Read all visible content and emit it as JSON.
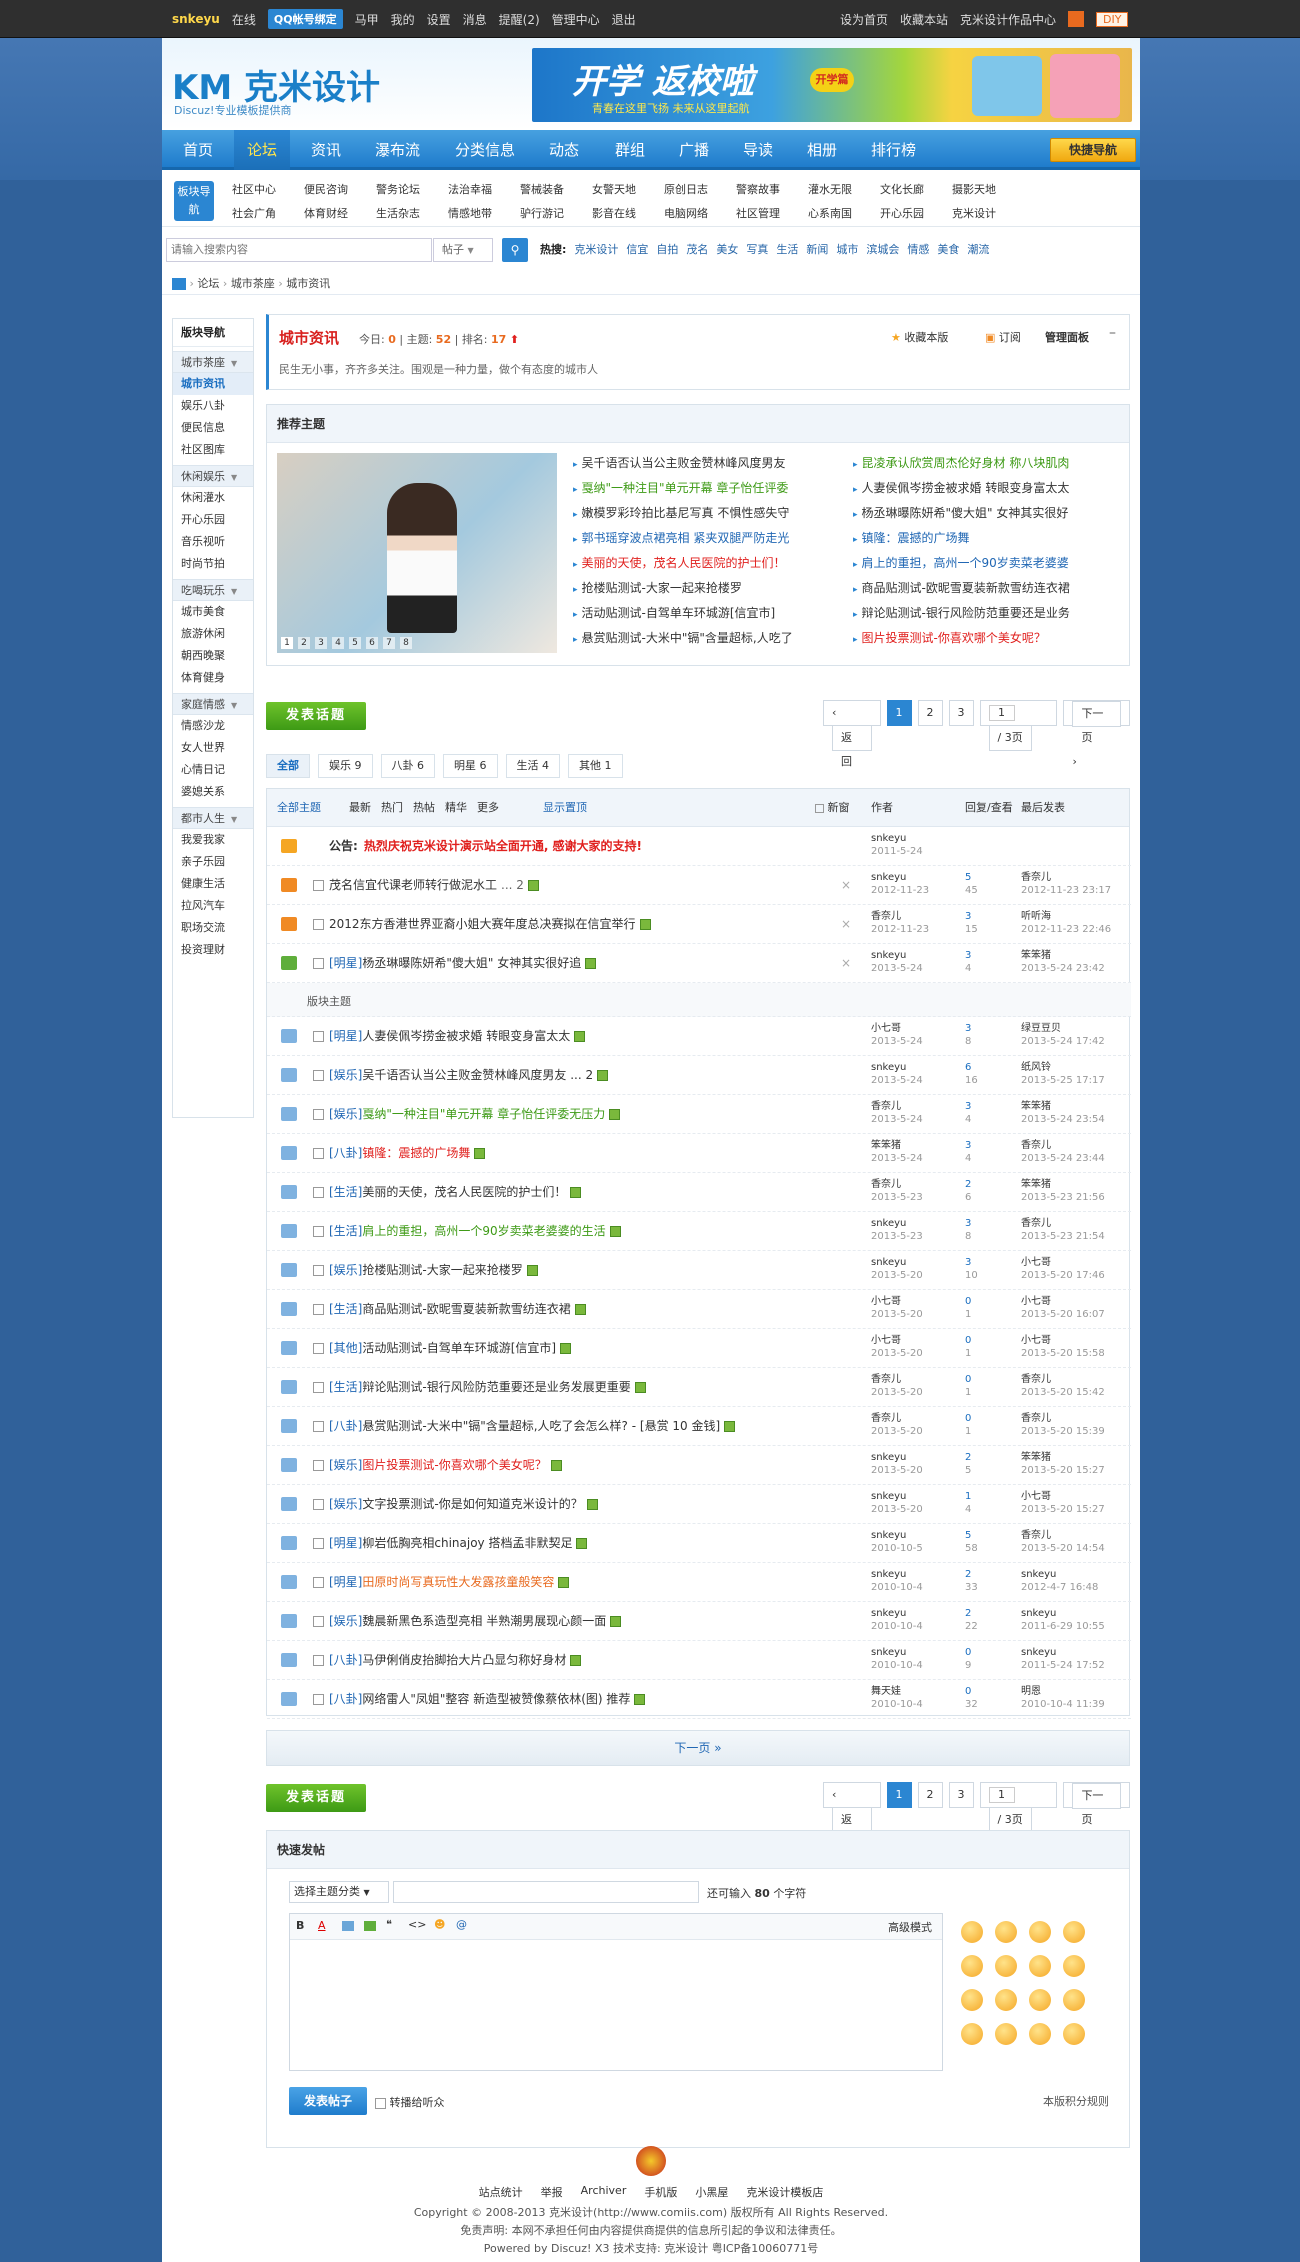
{
  "topbar": {
    "user": "snkeyu",
    "online": "在线",
    "qq": "QQ帐号绑定",
    "left_items": [
      "马甲",
      "我的",
      "设置",
      "消息",
      "提醒(2)",
      "管理中心",
      "退出"
    ],
    "right_items": [
      "设为首页",
      "收藏本站",
      "克米设计作品中心",
      "DIY"
    ]
  },
  "header": {
    "logo": "KM 克米设计",
    "tagline": "Discuz!专业模板提供商",
    "banner_title": "开学 返校啦",
    "banner_sub": "青春在这里飞扬 未来从这里起航",
    "banner_tag": "开学篇"
  },
  "nav": {
    "items": [
      "首页",
      "论坛",
      "资讯",
      "瀑布流",
      "分类信息",
      "动态",
      "群组",
      "广播",
      "导读",
      "相册",
      "排行榜"
    ],
    "quick": "快捷导航"
  },
  "subnav": {
    "label": "板块导航",
    "row1": [
      "社区中心",
      "便民咨询",
      "警务论坛",
      "法治幸福",
      "警械装备",
      "女警天地",
      "原创日志",
      "警察故事",
      "灌水无限",
      "文化长廊",
      "摄影天地"
    ],
    "row2": [
      "社会广角",
      "体育财经",
      "生活杂志",
      "情感地带",
      "驴行游记",
      "影音在线",
      "电脑网络",
      "社区管理",
      "心系南国",
      "开心乐园",
      "克米设计"
    ]
  },
  "search": {
    "placeholder": "请输入搜索内容",
    "type": "帖子",
    "hot_label": "热搜:",
    "hot": [
      "克米设计",
      "信宜",
      "自拍",
      "茂名",
      "美女",
      "写真",
      "生活",
      "新闻",
      "城市",
      "滨城会",
      "情感",
      "美食",
      "潮流"
    ]
  },
  "breadcrumb": [
    "论坛",
    "城市茶座",
    "城市资讯"
  ],
  "sidebar": {
    "title": "版块导航",
    "groups": [
      {
        "name": "城市茶座",
        "items": [
          "城市资讯",
          "娱乐八卦",
          "便民信息",
          "社区图库"
        ]
      },
      {
        "name": "休闲娱乐",
        "items": [
          "休闲灌水",
          "开心乐园",
          "音乐视听",
          "时尚节拍"
        ]
      },
      {
        "name": "吃喝玩乐",
        "items": [
          "城市美食",
          "旅游休闲",
          "朝西晚聚",
          "体育健身"
        ]
      },
      {
        "name": "家庭情感",
        "items": [
          "情感沙龙",
          "女人世界",
          "心情日记",
          "婆媳关系"
        ]
      },
      {
        "name": "都市人生",
        "items": [
          "我爱我家",
          "亲子乐园",
          "健康生活",
          "拉风汽车",
          "职场交流",
          "投资理财"
        ]
      }
    ]
  },
  "forum": {
    "name": "城市资讯",
    "today_label": "今日:",
    "today": "0",
    "threads_label": "主题:",
    "threads": "52",
    "rank_label": "排名:",
    "rank": "17",
    "desc": "民生无小事，齐齐多关注。围观是一种力量，做个有态度的城市人",
    "fav": "收藏本版",
    "rss": "订阅",
    "admin": "管理面板"
  },
  "featured": {
    "title": "推荐主题",
    "slides": [
      "1",
      "2",
      "3",
      "4",
      "5",
      "6",
      "7",
      "8"
    ],
    "left": [
      "吴千语否认当公主败金赞林峰风度男友",
      "戛纳\"一种注目\"单元开幕 章子怡任评委",
      "嫩模罗彩玲拍比基尼写真 不惧性感失守",
      "郭书瑶穿波点裙亮相 紧夹双腿严防走光",
      "美丽的天使，茂名人民医院的护士们！",
      "抢楼贴测试-大家一起来抢楼罗",
      "活动贴测试-自驾单车环城游[信宜市]",
      "悬赏贴测试-大米中\"镉\"含量超标,人吃了"
    ],
    "right": [
      "昆凌承认欣赏周杰伦好身材 称八块肌肉",
      "人妻侯佩岑捞金被求婚 转眼变身富太太",
      "杨丞琳曝陈妍希\"傻大姐\" 女神其实很好",
      "镇隆：震撼的广场舞",
      "肩上的重担，高州一个90岁卖菜老婆婆",
      "商品贴测试-欧昵雪夏装新款雪纺连衣裙",
      "辩论贴测试-银行风险防范重要还是业务",
      "图片投票测试-你喜欢哪个美女呢？"
    ]
  },
  "actions": {
    "post": "发表话题",
    "back": "返回",
    "pages": [
      "1",
      "2",
      "3"
    ],
    "page_input": "1",
    "total": "/ 3页",
    "next": "下一页"
  },
  "tabs": [
    "全部",
    "娱乐 9",
    "八卦 6",
    "明星 6",
    "生活 4",
    "其他 1"
  ],
  "listhead": {
    "filters": [
      "全部主题",
      "最新",
      "热门",
      "热帖",
      "精华",
      "更多"
    ],
    "show": "显示置顶",
    "newwin": "新窗",
    "author": "作者",
    "replies": "回复/查看",
    "last": "最后发表"
  },
  "announce": {
    "label": "公告:",
    "text": "热烈庆祝克米设计演示站全面开通, 感谢大家的支持!",
    "author": "snkeyu",
    "date": "2011-5-24"
  },
  "sticky": [
    {
      "tag": "",
      "title": "茂名信宜代课老师转行做泥水工",
      "extra": "... 2",
      "author": "snkeyu",
      "date": "2012-11-23",
      "r": "5",
      "v": "45",
      "lp": "香奈儿",
      "lpd": "2012-11-23 23:17"
    },
    {
      "tag": "",
      "title": "2012东方香港世界亚裔小姐大赛年度总决赛拟在信宜举行",
      "extra": "",
      "author": "香奈儿",
      "date": "2012-11-23",
      "r": "3",
      "v": "15",
      "lp": "听听海",
      "lpd": "2012-11-23 22:46"
    },
    {
      "tag": "[明星]",
      "title": "杨丞琳曝陈妍希\"傻大姐\" 女神其实很好追",
      "extra": "",
      "author": "snkeyu",
      "date": "2013-5-24",
      "r": "3",
      "v": "4",
      "lp": "笨笨猪",
      "lpd": "2013-5-24 23:42"
    }
  ],
  "section_label": "版块主题",
  "threads": [
    {
      "tag": "[明星]",
      "title": "人妻侯佩岑捞金被求婚 转眼变身富太太",
      "author": "小七哥",
      "date": "2013-5-24",
      "r": "3",
      "v": "8",
      "lp": "绿豆豆贝",
      "lpd": "2013-5-24 17:42"
    },
    {
      "tag": "[娱乐]",
      "title": "吴千语否认当公主败金赞林峰风度男友 ... 2",
      "author": "snkeyu",
      "date": "2013-5-24",
      "r": "6",
      "v": "16",
      "lp": "纸风铃",
      "lpd": "2013-5-25 17:17"
    },
    {
      "tag": "[娱乐]",
      "title": "戛纳\"一种注目\"单元开幕 章子怡任评委无压力",
      "author": "香奈儿",
      "date": "2013-5-24",
      "r": "3",
      "v": "4",
      "lp": "笨笨猪",
      "lpd": "2013-5-24 23:54"
    },
    {
      "tag": "[八卦]",
      "title": "镇隆：震撼的广场舞",
      "author": "笨笨猪",
      "date": "2013-5-24",
      "r": "3",
      "v": "4",
      "lp": "香奈儿",
      "lpd": "2013-5-24 23:44"
    },
    {
      "tag": "[生活]",
      "title": "美丽的天使，茂名人民医院的护士们！",
      "author": "香奈儿",
      "date": "2013-5-23",
      "r": "2",
      "v": "6",
      "lp": "笨笨猪",
      "lpd": "2013-5-23 21:56"
    },
    {
      "tag": "[生活]",
      "title": "肩上的重担，高州一个90岁卖菜老婆婆的生活",
      "author": "snkeyu",
      "date": "2013-5-23",
      "r": "3",
      "v": "8",
      "lp": "香奈儿",
      "lpd": "2013-5-23 21:54"
    },
    {
      "tag": "[娱乐]",
      "title": "抢楼贴测试-大家一起来抢楼罗",
      "author": "snkeyu",
      "date": "2013-5-20",
      "r": "3",
      "v": "10",
      "lp": "小七哥",
      "lpd": "2013-5-20 17:46"
    },
    {
      "tag": "[生活]",
      "title": "商品贴测试-欧昵雪夏装新款雪纺连衣裙",
      "author": "小七哥",
      "date": "2013-5-20",
      "r": "0",
      "v": "1",
      "lp": "小七哥",
      "lpd": "2013-5-20 16:07"
    },
    {
      "tag": "[其他]",
      "title": "活动贴测试-自驾单车环城游[信宜市]",
      "author": "小七哥",
      "date": "2013-5-20",
      "r": "0",
      "v": "1",
      "lp": "小七哥",
      "lpd": "2013-5-20 15:58"
    },
    {
      "tag": "[生活]",
      "title": "辩论贴测试-银行风险防范重要还是业务发展更重要",
      "author": "香奈儿",
      "date": "2013-5-20",
      "r": "0",
      "v": "1",
      "lp": "香奈儿",
      "lpd": "2013-5-20 15:42"
    },
    {
      "tag": "[八卦]",
      "title": "悬赏贴测试-大米中\"镉\"含量超标,人吃了会怎么样? - [悬赏 10 金钱]",
      "author": "香奈儿",
      "date": "2013-5-20",
      "r": "0",
      "v": "1",
      "lp": "香奈儿",
      "lpd": "2013-5-20 15:39"
    },
    {
      "tag": "[娱乐]",
      "title": "图片投票测试-你喜欢哪个美女呢？",
      "author": "snkeyu",
      "date": "2013-5-20",
      "r": "2",
      "v": "5",
      "lp": "笨笨猪",
      "lpd": "2013-5-20 15:27"
    },
    {
      "tag": "[娱乐]",
      "title": "文字投票测试-你是如何知道克米设计的？",
      "author": "snkeyu",
      "date": "2013-5-20",
      "r": "1",
      "v": "4",
      "lp": "小七哥",
      "lpd": "2013-5-20 15:27"
    },
    {
      "tag": "[明星]",
      "title": "柳岩低胸亮相chinajoy 搭档孟非默契足",
      "author": "snkeyu",
      "date": "2010-10-5",
      "r": "5",
      "v": "58",
      "lp": "香奈儿",
      "lpd": "2013-5-20 14:54"
    },
    {
      "tag": "[明星]",
      "title": "田原时尚写真玩性大发露孩童般笑容",
      "author": "snkeyu",
      "date": "2010-10-4",
      "r": "2",
      "v": "33",
      "lp": "snkeyu",
      "lpd": "2012-4-7 16:48"
    },
    {
      "tag": "[娱乐]",
      "title": "魏晨新黑色系造型亮相 半熟潮男展现心颜一面",
      "author": "snkeyu",
      "date": "2010-10-4",
      "r": "2",
      "v": "22",
      "lp": "snkeyu",
      "lpd": "2011-6-29 10:55"
    },
    {
      "tag": "[八卦]",
      "title": "马伊俐俏皮抬脚抬大片凸显匀称好身材",
      "author": "snkeyu",
      "date": "2010-10-4",
      "r": "0",
      "v": "9",
      "lp": "snkeyu",
      "lpd": "2011-5-24 17:52"
    },
    {
      "tag": "[八卦]",
      "title": "网络雷人\"凤姐\"整容 新造型被赞像蔡依林(图) 推荐",
      "author": "舞天娃",
      "date": "2010-10-4",
      "r": "0",
      "v": "32",
      "lp": "明恩",
      "lpd": "2010-10-4 11:39"
    }
  ],
  "next_page": "下一页 »",
  "quickpost": {
    "title": "快速发帖",
    "category": "选择主题分类",
    "limit_pre": "还可输入",
    "limit": "80",
    "limit_post": "个字符",
    "advanced": "高级模式",
    "submit": "发表帖子",
    "broadcast": "转播给听众",
    "rules": "本版积分规则"
  },
  "footer": {
    "links": [
      "站点统计",
      "举报",
      "Archiver",
      "手机版",
      "小黑屋",
      "克米设计模板店"
    ],
    "copy": "Copyright © 2008-2013 克米设计(http://www.comiis.com) 版权所有 All Rights Reserved.",
    "disclaimer": "免责声明: 本网不承担任何由内容提供商提供的信息所引起的争议和法律责任。",
    "powered": "Powered by Discuz! X3  技术支持: 克米设计 粤ICP备10060771号"
  },
  "colors": {
    "accent": "#2b86d2",
    "red": "#e0201e",
    "green": "#3d9a15",
    "link": "#1f66b3"
  }
}
